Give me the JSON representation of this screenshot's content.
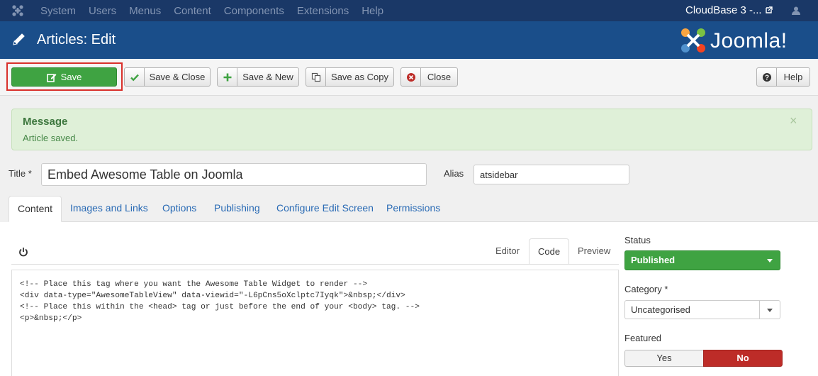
{
  "topbar": {
    "menu": [
      "System",
      "Users",
      "Menus",
      "Content",
      "Components",
      "Extensions",
      "Help"
    ],
    "site_name": "CloudBase 3 -...",
    "icons": {
      "logo": "joomla-icon",
      "external": "external-link-icon",
      "user": "user-icon"
    }
  },
  "header": {
    "title": "Articles: Edit",
    "brand": "Joomla!",
    "icons": {
      "page": "pencil-icon"
    }
  },
  "toolbar": {
    "save": "Save",
    "save_close": "Save & Close",
    "save_new": "Save & New",
    "save_copy": "Save as Copy",
    "close": "Close",
    "help": "Help",
    "icons": [
      "edit-icon",
      "check-icon",
      "plus-icon",
      "copy-icon",
      "cancel-icon",
      "question-icon"
    ]
  },
  "message": {
    "heading": "Message",
    "text": "Article saved.",
    "close": "×"
  },
  "form": {
    "title_label": "Title *",
    "title_value": "Embed Awesome Table on Joomla",
    "alias_label": "Alias",
    "alias_value": "atsidebar"
  },
  "tabs": [
    "Content",
    "Images and Links",
    "Options",
    "Publishing",
    "Configure Edit Screen",
    "Permissions"
  ],
  "active_tab": "Content",
  "editor": {
    "tabs": [
      "Editor",
      "Code",
      "Preview"
    ],
    "active_tab": "Code",
    "code_lines": [
      "<!-- Place this tag where you want the Awesome Table Widget to render -->",
      "<div data-type=\"AwesomeTableView\" data-viewid=\"-L6pCns5oXclptc7Iyqk\">&nbsp;</div>",
      "<!-- Place this within the <head> tag or just before the end of your <body> tag. -->",
      "<p>&nbsp;</p>"
    ]
  },
  "sidebar": {
    "status_label": "Status",
    "status_value": "Published",
    "category_label": "Category *",
    "category_value": "Uncategorised",
    "featured_label": "Featured",
    "featured_yes": "Yes",
    "featured_no": "No",
    "featured_value": "No"
  },
  "colors": {
    "topbar": "#1a3867",
    "header": "#1a4e8a",
    "success": "#3fa342",
    "danger": "#bd2c28",
    "message_bg": "#dff0d8",
    "highlight": "#d9302b"
  }
}
